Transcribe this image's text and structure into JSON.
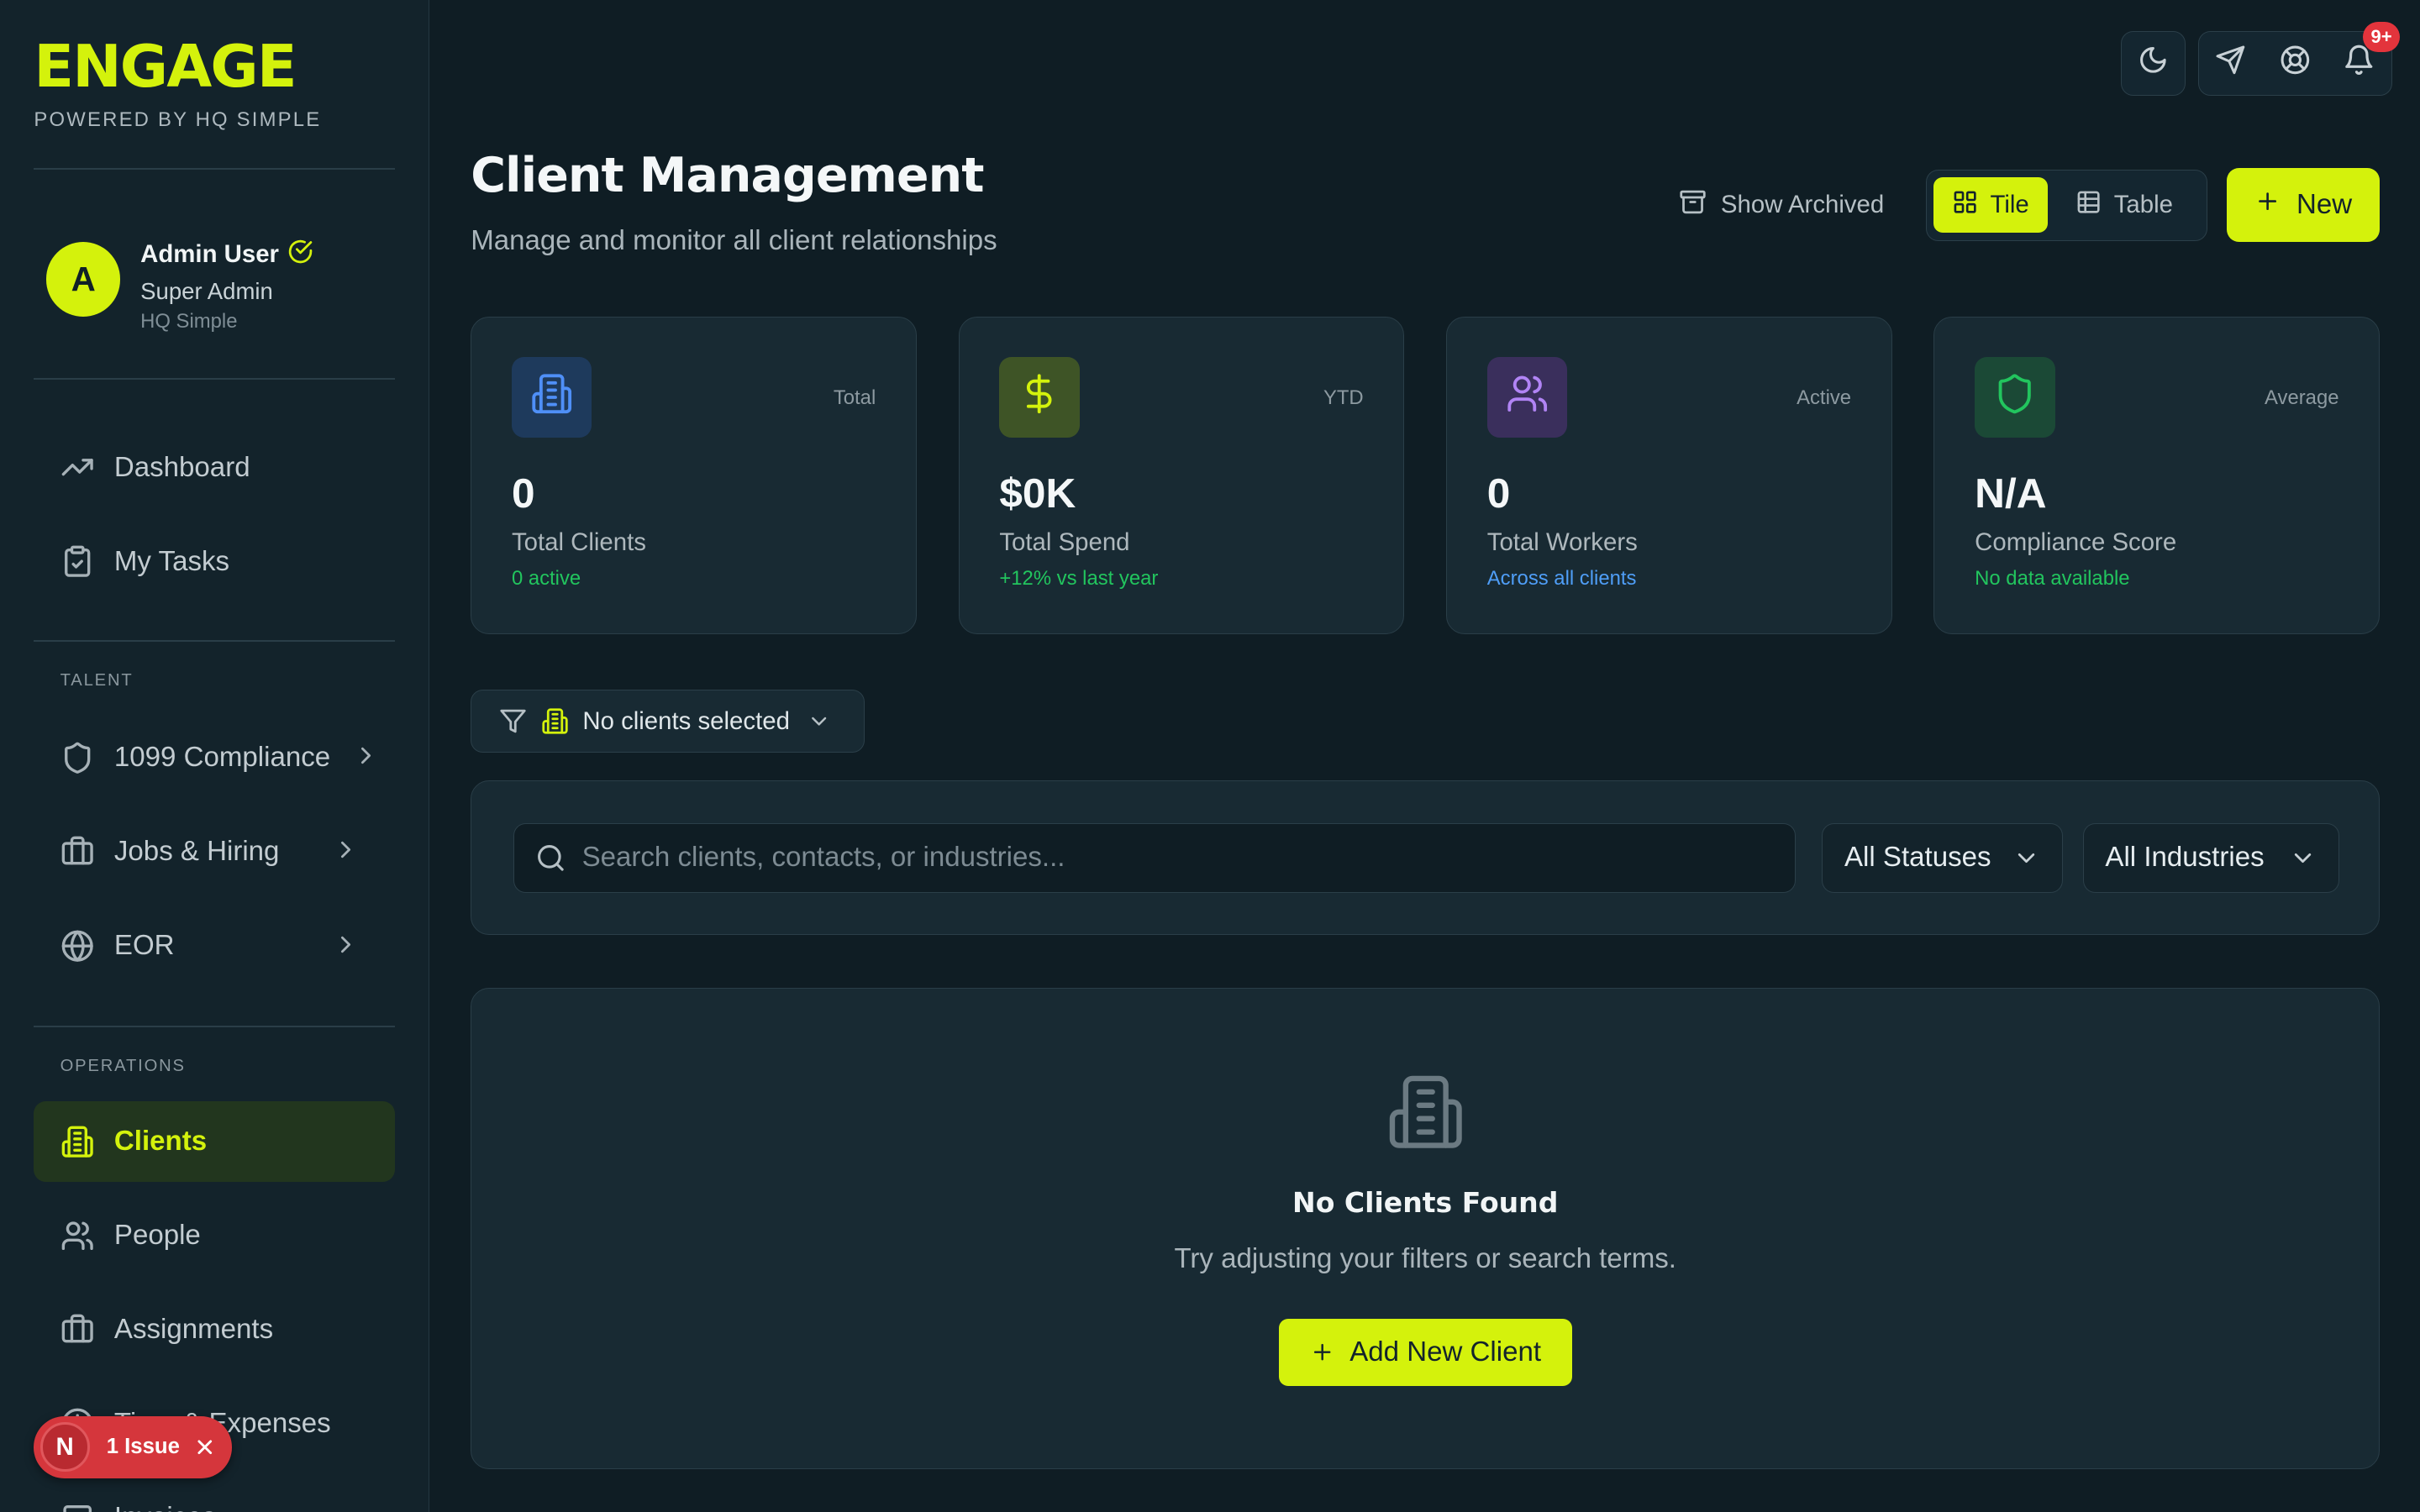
{
  "brand": {
    "title": "ENGAGE",
    "subtitle": "POWERED BY HQ SIMPLE"
  },
  "user": {
    "initial": "A",
    "name": "Admin User",
    "role": "Super Admin",
    "org": "HQ Simple"
  },
  "nav": {
    "dashboard": "Dashboard",
    "tasks": "My Tasks",
    "talent_label": "TALENT",
    "compliance": "1099 Compliance",
    "jobs": "Jobs & Hiring",
    "eor": "EOR",
    "operations_label": "OPERATIONS",
    "clients": "Clients",
    "people": "People",
    "assignments": "Assignments",
    "time_expenses": "Time & Expenses",
    "invoices": "Invoices"
  },
  "issue": {
    "letter": "N",
    "label": "1 Issue"
  },
  "topbar": {
    "notifications_badge": "9+"
  },
  "header": {
    "title": "Client Management",
    "subtitle": "Manage and monitor all client relationships",
    "show_archived": "Show Archived",
    "view_tile": "Tile",
    "view_table": "Table",
    "new_button": "New"
  },
  "stats": [
    {
      "tag": "Total",
      "value": "0",
      "label": "Total Clients",
      "sub": "0 active",
      "sub_color": "#22c55e",
      "icon": "building-icon",
      "icon_color": "#4f8ff7",
      "icon_bg": "#1e3a5c"
    },
    {
      "tag": "YTD",
      "value": "$0K",
      "label": "Total Spend",
      "sub": "+12% vs last year",
      "sub_color": "#22c55e",
      "icon": "dollar-icon",
      "icon_color": "#d4f20c",
      "icon_bg": "#3e5426"
    },
    {
      "tag": "Active",
      "value": "0",
      "label": "Total Workers",
      "sub": "Across all clients",
      "sub_color": "#4f9ef7",
      "icon": "users-icon",
      "icon_color": "#b184f5",
      "icon_bg": "#3a2f5c"
    },
    {
      "tag": "Average",
      "value": "N/A",
      "label": "Compliance Score",
      "sub": "No data available",
      "sub_color": "#22c55e",
      "icon": "shield-icon",
      "icon_color": "#22c55e",
      "icon_bg": "#1b4936"
    }
  ],
  "client_selector": {
    "label": "No clients selected"
  },
  "filters": {
    "search_placeholder": "Search clients, contacts, or industries...",
    "status": "All Statuses",
    "industry": "All Industries"
  },
  "empty_state": {
    "title": "No Clients Found",
    "message": "Try adjusting your filters or search terms.",
    "button": "Add New Client"
  },
  "colors": {
    "accent": "#d4f20c",
    "background": "#0f1d24",
    "panel": "#182a33"
  }
}
